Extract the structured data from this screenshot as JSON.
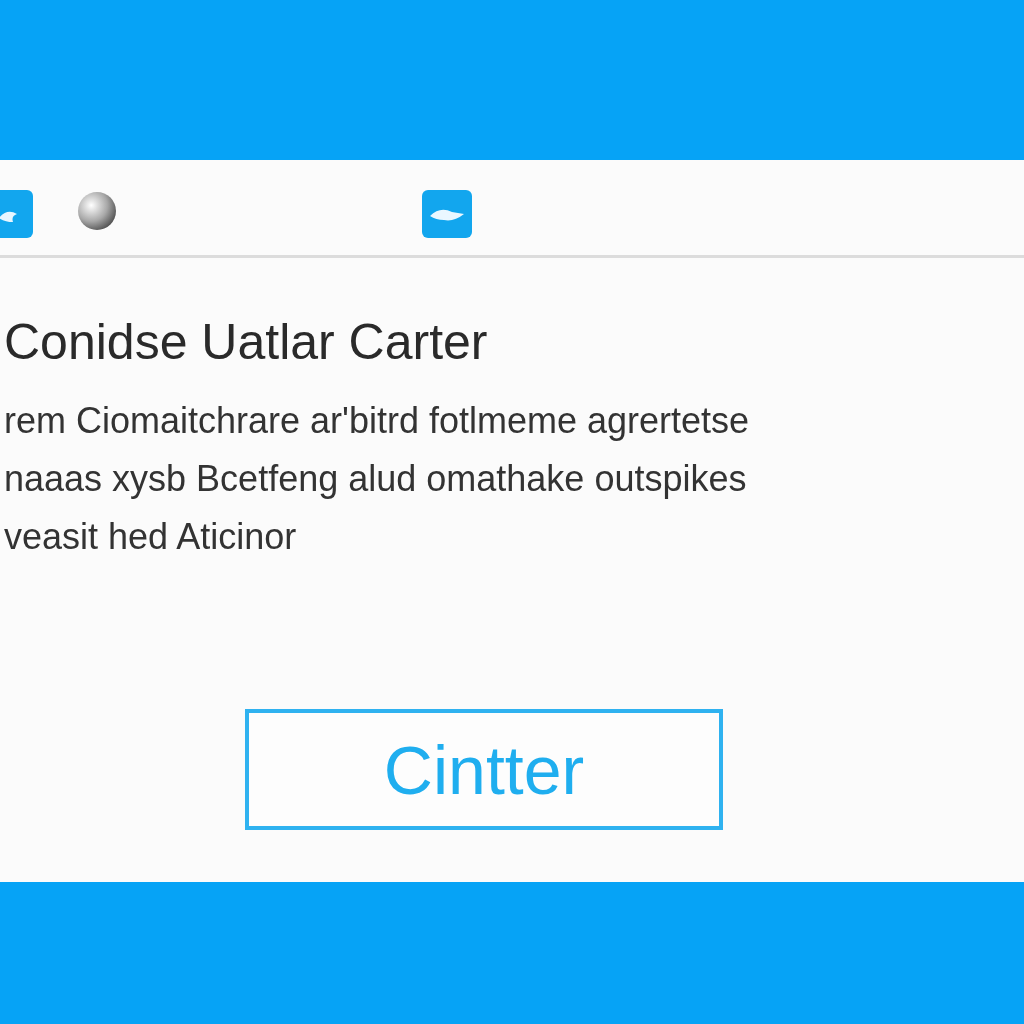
{
  "dialog": {
    "title": "Conidse Uatlar Carter",
    "message_lines": [
      "rem Ciomaitchrare ar'bitrd fotlmeme agrertetse",
      "naaas xysb Bcetfeng alud omathake outspikes",
      "veasit hed Aticinor"
    ],
    "button": "Cintter"
  }
}
